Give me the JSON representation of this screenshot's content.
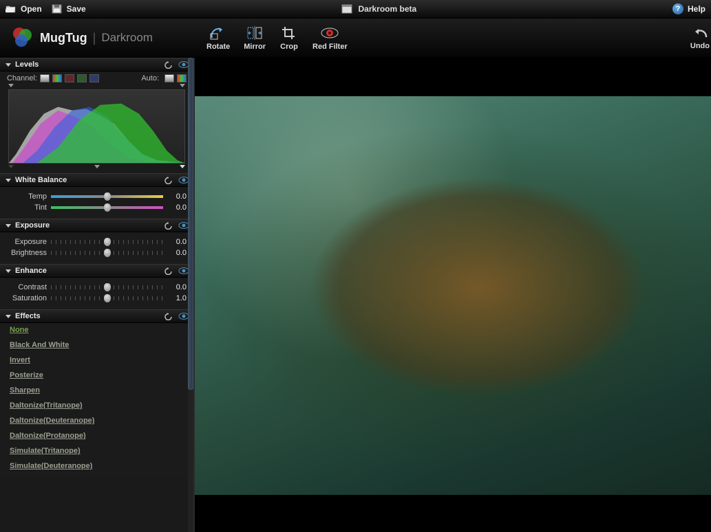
{
  "topbar": {
    "open_label": "Open",
    "save_label": "Save",
    "app_title": "Darkroom beta",
    "help_label": "Help"
  },
  "brand": {
    "name": "MugTug",
    "product": "Darkroom"
  },
  "tools": {
    "rotate": "Rotate",
    "mirror": "Mirror",
    "crop": "Crop",
    "red_filter": "Red Filter",
    "undo": "Undo"
  },
  "panels": {
    "levels": {
      "title": "Levels",
      "channel_label": "Channel:",
      "auto_label": "Auto:"
    },
    "white_balance": {
      "title": "White Balance",
      "temp_label": "Temp",
      "temp_value": "0.0",
      "tint_label": "Tint",
      "tint_value": "0.0"
    },
    "exposure": {
      "title": "Exposure",
      "exposure_label": "Exposure",
      "exposure_value": "0.0",
      "brightness_label": "Brightness",
      "brightness_value": "0.0"
    },
    "enhance": {
      "title": "Enhance",
      "contrast_label": "Contrast",
      "contrast_value": "0.0",
      "saturation_label": "Saturation",
      "saturation_value": "1.0"
    },
    "effects": {
      "title": "Effects",
      "items": [
        "None",
        "Black And White",
        "Invert",
        "Posterize",
        "Sharpen",
        "Daltonize(Tritanope)",
        "Daltonize(Deuteranope)",
        "Daltonize(Protanope)",
        "Simulate(Tritanope)",
        "Simulate(Deuteranope)"
      ],
      "active_index": 0
    }
  }
}
